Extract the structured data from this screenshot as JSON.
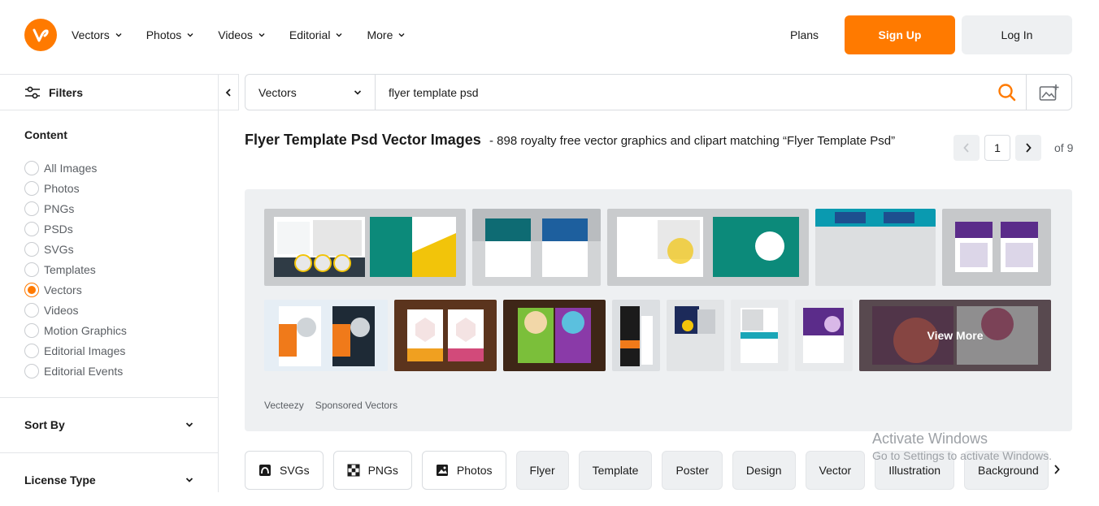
{
  "header": {
    "nav": [
      "Vectors",
      "Photos",
      "Videos",
      "Editorial",
      "More"
    ],
    "plans": "Plans",
    "signup": "Sign Up",
    "login": "Log In",
    "accent": "#ff7a00"
  },
  "sidebar": {
    "filters_label": "Filters",
    "content_title": "Content",
    "content_options": [
      "All Images",
      "Photos",
      "PNGs",
      "PSDs",
      "SVGs",
      "Templates",
      "Vectors",
      "Videos",
      "Motion Graphics",
      "Editorial Images",
      "Editorial Events"
    ],
    "selected": "Vectors",
    "sort_by": "Sort By",
    "license_type": "License Type"
  },
  "search": {
    "type": "Vectors",
    "query": "flyer template psd"
  },
  "results": {
    "heading": "Flyer Template Psd Vector Images",
    "subheading": "- 898 royalty free vector graphics and clipart matching “Flyer Template Psd”",
    "page": "1",
    "of_pages": "of 9"
  },
  "sponsored": {
    "brand": "Vecteezy",
    "label": "Sponsored Vectors",
    "view_more": "View More"
  },
  "chips": [
    "SVGs",
    "PNGs",
    "Photos",
    "Flyer",
    "Template",
    "Poster",
    "Design",
    "Vector",
    "Illustration",
    "Background"
  ],
  "watermark": {
    "line1": "Activate Windows",
    "line2": "Go to Settings to activate Windows."
  }
}
